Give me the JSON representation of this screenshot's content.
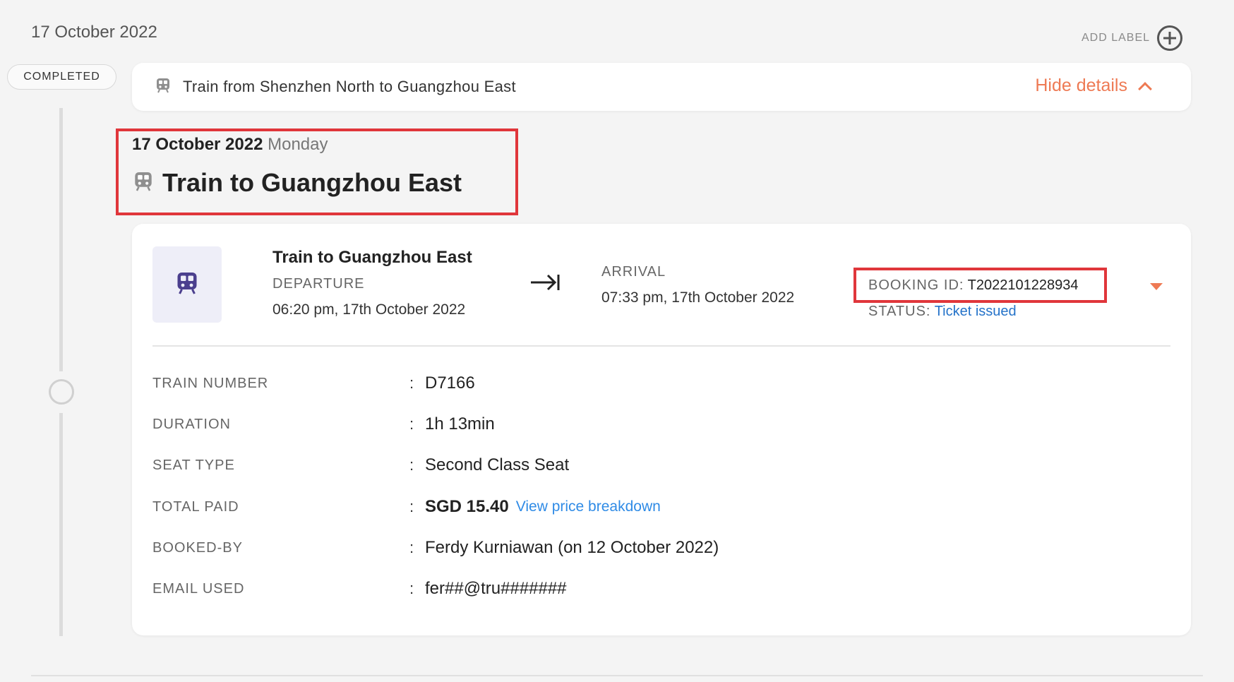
{
  "header": {
    "date": "17 October 2022",
    "add_label": "ADD LABEL"
  },
  "timeline": {
    "status": "COMPLETED"
  },
  "summary": {
    "title": "Train from Shenzhen North to Guangzhou East",
    "hide_details": "Hide details"
  },
  "segment_header": {
    "date": "17 October 2022",
    "day": "Monday",
    "title": "Train to Guangzhou East"
  },
  "card": {
    "title": "Train to Guangzhou East",
    "departure_label": "DEPARTURE",
    "departure_time": "06:20 pm, 17th October 2022",
    "arrival_label": "ARRIVAL",
    "arrival_time": "07:33 pm, 17th October 2022",
    "booking_id_label": "BOOKING ID:",
    "booking_id": "T2022101228934",
    "status_label": "STATUS:",
    "status_value": "Ticket issued",
    "details": [
      {
        "label": "TRAIN NUMBER",
        "value": "D7166"
      },
      {
        "label": "DURATION",
        "value": "1h 13min"
      },
      {
        "label": "SEAT TYPE",
        "value": "Second Class Seat"
      },
      {
        "label": "TOTAL PAID",
        "value": "SGD 15.40",
        "link": "View price breakdown"
      },
      {
        "label": "BOOKED-BY",
        "value": "Ferdy Kurniawan (on 12 October 2022)"
      },
      {
        "label": "EMAIL USED",
        "value": "fer##@tru#######"
      }
    ]
  },
  "colors": {
    "accent": "#ee7a54",
    "link": "#2f8be6",
    "status": "#2573c9",
    "highlight": "#e0363b",
    "train_icon": "#4b3f8e"
  }
}
